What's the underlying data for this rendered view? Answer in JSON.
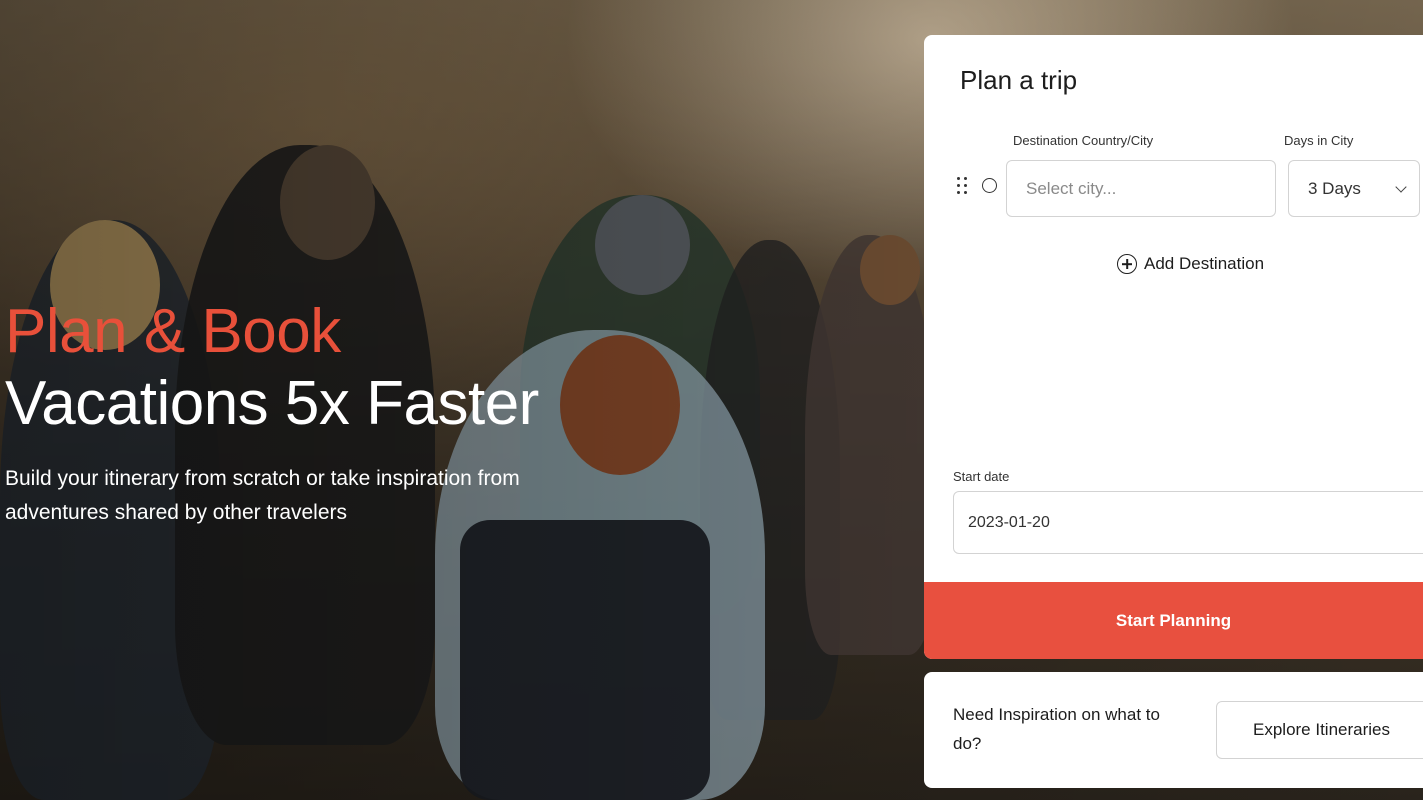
{
  "hero": {
    "line1": "Plan & Book",
    "line2": "Vacations 5x Faster",
    "subtitle": "Build your itinerary from scratch or take inspiration from adventures shared by other travelers",
    "accent_color": "#e8503a"
  },
  "planner": {
    "title": "Plan a trip",
    "destination_label": "Destination Country/City",
    "days_label": "Days in City",
    "city_placeholder": "Select city...",
    "days_value": "3 Days",
    "add_destination_label": "Add Destination",
    "start_date_label": "Start date",
    "start_date_value": "2023-01-20",
    "start_button_label": "Start Planning",
    "button_color": "#e8503f"
  },
  "inspiration": {
    "text": "Need Inspiration on what to do?",
    "button_label": "Explore Itineraries"
  },
  "icons": {
    "drag": "drag-handle-icon",
    "radio": "radio-circle-icon",
    "chevron": "chevron-down-icon",
    "add": "plus-circle-icon"
  }
}
